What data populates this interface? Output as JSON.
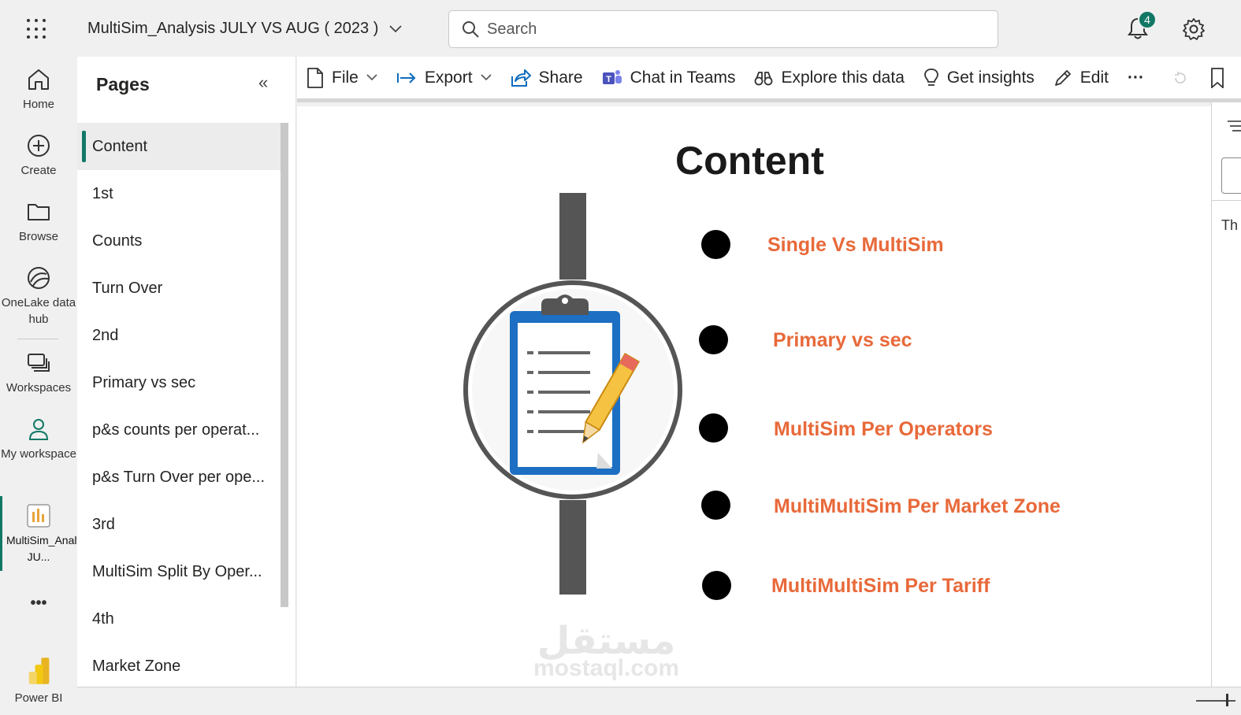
{
  "topbar": {
    "report_title": "MultiSim_Analysis JULY VS AUG ( 2023 )",
    "search_placeholder": "Search",
    "notification_count": "4"
  },
  "leftnav": {
    "items": [
      {
        "label": "Home",
        "icon": "home-icon"
      },
      {
        "label": "Create",
        "icon": "plus-circle-icon"
      },
      {
        "label": "Browse",
        "icon": "folder-icon"
      },
      {
        "label": "OneLake data hub",
        "icon": "onelake-icon"
      },
      {
        "label": "Workspaces",
        "icon": "workspaces-icon"
      },
      {
        "label": "My workspace",
        "icon": "person-icon"
      },
      {
        "label": "MultiSim_Analysis JU...",
        "icon": "report-icon"
      }
    ],
    "more": "•••",
    "footer_label": "Power BI"
  },
  "pages_panel": {
    "title": "Pages",
    "collapse_glyph": "«",
    "pages": [
      "Content",
      "1st",
      "Counts",
      "Turn Over",
      "2nd",
      "Primary vs sec",
      "p&s counts per operat...",
      "p&s Turn Over per ope...",
      "3rd",
      "MultiSim Split By Oper...",
      "4th",
      "Market Zone"
    ],
    "active_page": "Content"
  },
  "toolbar": {
    "file": "File",
    "export": "Export",
    "share": "Share",
    "chat_in_teams": "Chat in Teams",
    "explore": "Explore this data",
    "insights": "Get insights",
    "edit": "Edit",
    "more": "···"
  },
  "report": {
    "title": "Content",
    "items": [
      "Single Vs MultiSim",
      "Primary vs sec",
      "MultiSim Per Operators",
      "MultiMultiSim Per Market Zone",
      "MultiMultiSim Per Tariff"
    ],
    "accent_color": "#e8693a",
    "watermark_arabic": "مستقل",
    "watermark_latin": "mostaql.com"
  },
  "right_pane": {
    "partial_text": "Th"
  }
}
